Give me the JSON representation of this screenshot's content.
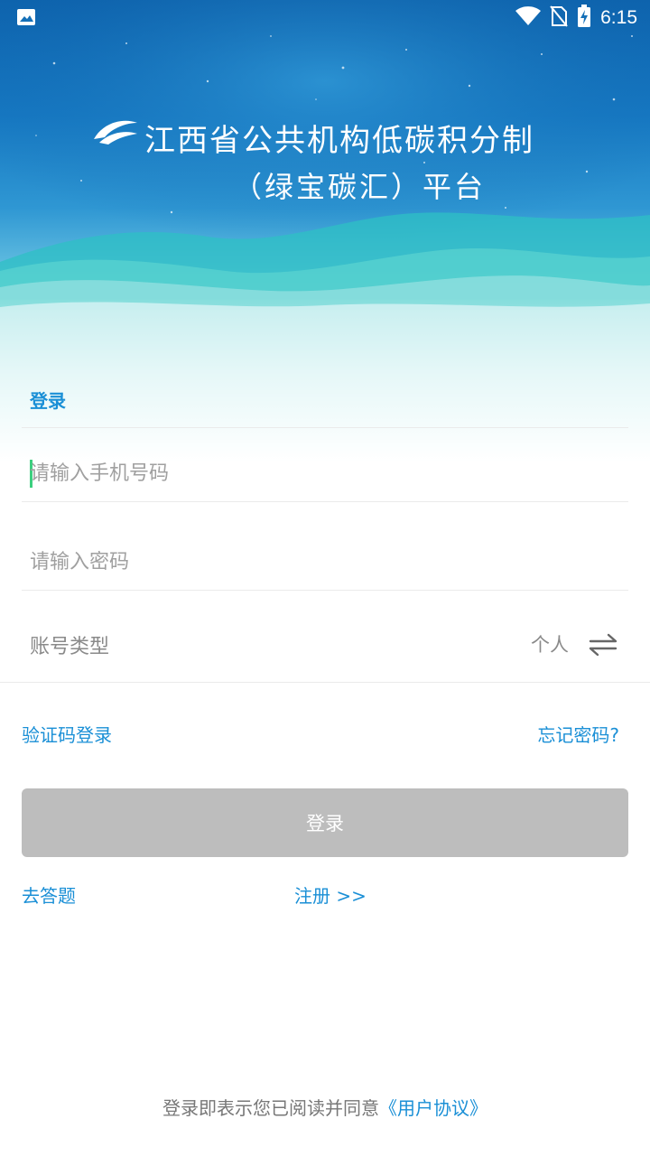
{
  "status_bar": {
    "time": "6:15",
    "icons": [
      "image-icon",
      "wifi-icon",
      "no-sim-icon",
      "battery-charging-icon"
    ]
  },
  "header": {
    "title_line1": "江西省公共机构低碳积分制",
    "title_line2": "（绿宝碳汇）平台",
    "logo": "leaf-logo"
  },
  "form": {
    "heading": "登录",
    "phone_placeholder": "请输入手机号码",
    "phone_value": "",
    "password_placeholder": "请输入密码",
    "password_value": "",
    "account_type_label": "账号类型",
    "account_type_value": "个人"
  },
  "links": {
    "sms_login": "验证码登录",
    "forgot_password": "忘记密码?",
    "quiz": "去答题",
    "register": "注册 >>"
  },
  "buttons": {
    "login": "登录"
  },
  "footer": {
    "prefix": "登录即表示您已阅读并同意",
    "agreement": "《用户协议》"
  },
  "colors": {
    "accent": "#1a8fd6",
    "button_disabled": "#bdbdbd",
    "caret": "#3ccf7f"
  }
}
